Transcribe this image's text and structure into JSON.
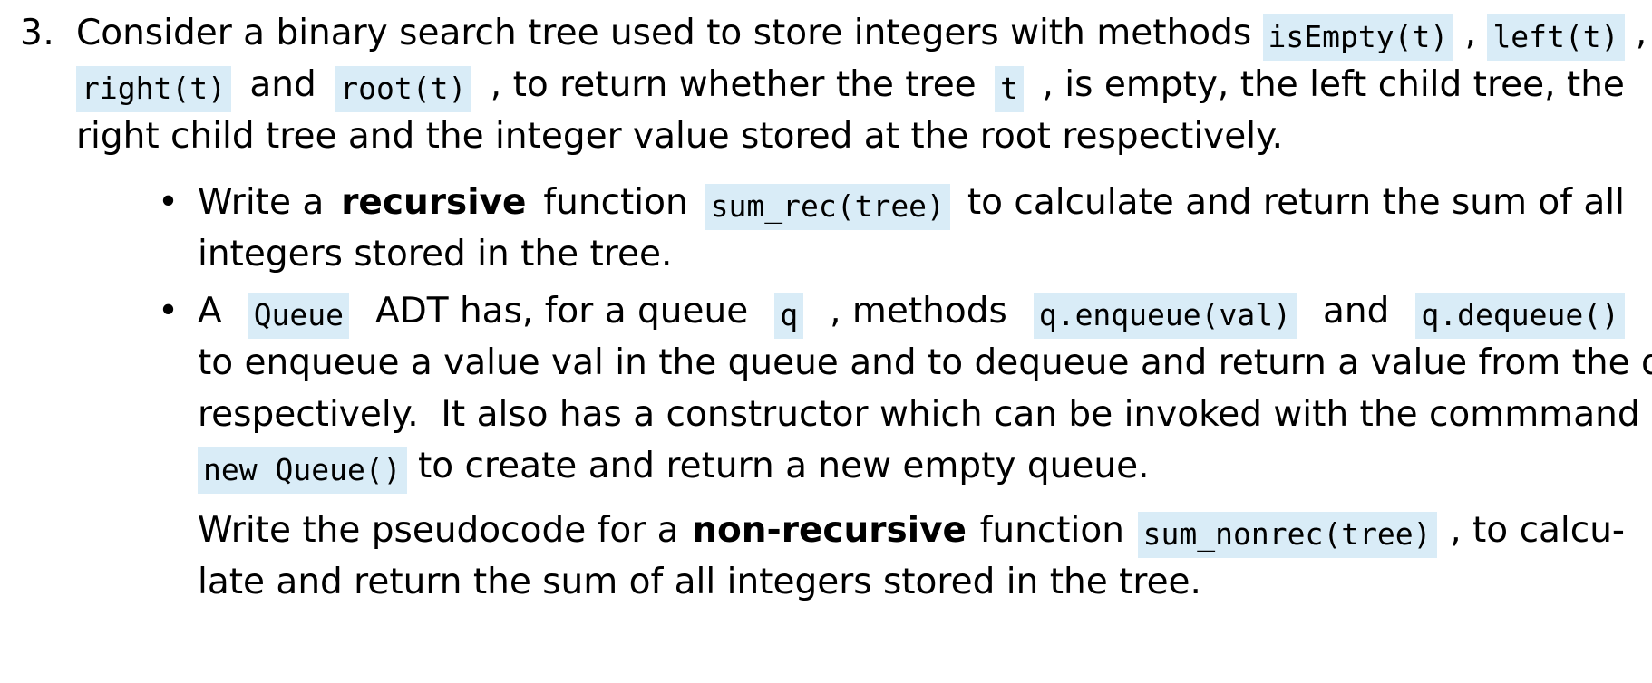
{
  "document": {
    "question_number": "3.",
    "bullet_marker": "•",
    "accent_code_bg": "#d9ecf7",
    "text_color": "#000000",
    "page_bg": "#ffffff",
    "intro": {
      "lines": [
        {
          "justify": true,
          "parts": [
            {
              "type": "text",
              "text": "Consider a binary search tree used to store integers with methods "
            },
            {
              "type": "code",
              "text": "isEmpty(t)"
            },
            {
              "type": "text",
              "text": " , "
            },
            {
              "type": "code",
              "text": "left(t)"
            },
            {
              "type": "text",
              "text": " ,"
            }
          ]
        },
        {
          "justify": true,
          "parts": [
            {
              "type": "code",
              "text": "right(t)"
            },
            {
              "type": "text",
              "text": " and "
            },
            {
              "type": "code",
              "text": "root(t)"
            },
            {
              "type": "text",
              "text": " , to return whether the tree "
            },
            {
              "type": "code",
              "text": "t"
            },
            {
              "type": "text",
              "text": " , is empty, the left child tree, the"
            }
          ]
        },
        {
          "justify": false,
          "parts": [
            {
              "type": "text",
              "text": "right child tree and the integer value stored at the root respectively."
            }
          ]
        }
      ]
    },
    "bullets": [
      {
        "name": "bullet-sum-rec",
        "paragraphs": [
          {
            "lines": [
              {
                "justify": true,
                "parts": [
                  {
                    "type": "text",
                    "text": "Write a "
                  },
                  {
                    "type": "bold",
                    "text": "recursive"
                  },
                  {
                    "type": "text",
                    "text": " function "
                  },
                  {
                    "type": "code",
                    "text": "sum_rec(tree)"
                  },
                  {
                    "type": "text",
                    "text": " to calculate and return the sum of all"
                  }
                ]
              },
              {
                "justify": false,
                "parts": [
                  {
                    "type": "text",
                    "text": "integers stored in the tree."
                  }
                ]
              }
            ]
          }
        ]
      },
      {
        "name": "bullet-queue-adt",
        "paragraphs": [
          {
            "lines": [
              {
                "justify": true,
                "parts": [
                  {
                    "type": "text",
                    "text": "A "
                  },
                  {
                    "type": "code",
                    "text": "Queue"
                  },
                  {
                    "type": "text",
                    "text": " ADT has, for a queue "
                  },
                  {
                    "type": "code",
                    "text": "q"
                  },
                  {
                    "type": "text",
                    "text": " , methods "
                  },
                  {
                    "type": "code",
                    "text": "q.enqueue(val)"
                  },
                  {
                    "type": "text",
                    "text": " and "
                  },
                  {
                    "type": "code",
                    "text": "q.dequeue()"
                  }
                ]
              },
              {
                "justify": true,
                "parts": [
                  {
                    "type": "text",
                    "text": "to enqueue a value val in the queue and to dequeue and return a value from the queue"
                  }
                ]
              },
              {
                "justify": true,
                "parts": [
                  {
                    "type": "text",
                    "text": "respectively.  It also has a constructor which can be invoked with the commmand"
                  }
                ]
              },
              {
                "justify": false,
                "parts": [
                  {
                    "type": "code",
                    "text": "new Queue()"
                  },
                  {
                    "type": "text",
                    "text": " to create and return a new empty queue."
                  }
                ]
              }
            ]
          },
          {
            "lines": [
              {
                "justify": true,
                "parts": [
                  {
                    "type": "text",
                    "text": "Write the pseudocode for a "
                  },
                  {
                    "type": "bold",
                    "text": "non-recursive"
                  },
                  {
                    "type": "text",
                    "text": " function "
                  },
                  {
                    "type": "code",
                    "text": "sum_nonrec(tree)"
                  },
                  {
                    "type": "text",
                    "text": " , to calcu-"
                  }
                ]
              },
              {
                "justify": false,
                "parts": [
                  {
                    "type": "text",
                    "text": "late and return the sum of all integers stored in the tree."
                  }
                ]
              }
            ]
          }
        ]
      }
    ]
  }
}
